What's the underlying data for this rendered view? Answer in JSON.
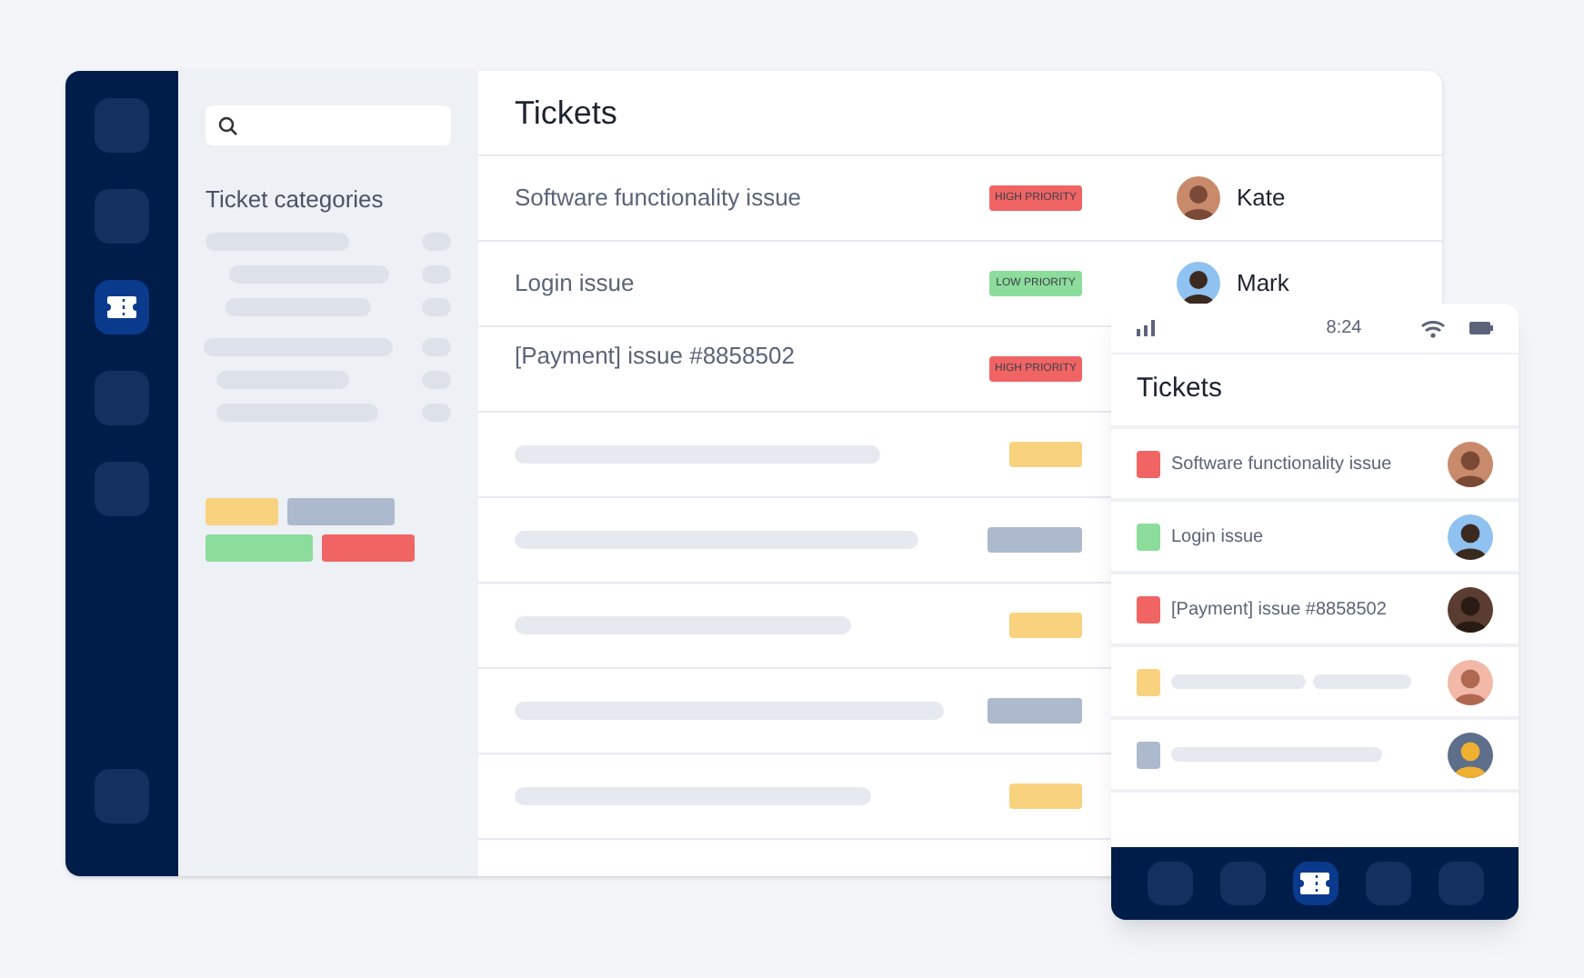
{
  "nav": {
    "items": [
      {
        "selected": false
      },
      {
        "selected": false
      },
      {
        "selected": true
      },
      {
        "selected": false
      },
      {
        "selected": false
      }
    ],
    "footer_items": [
      {
        "selected": false
      }
    ]
  },
  "sidebar": {
    "title": "Ticket categories",
    "tags": [
      {
        "color": "#f9d27f"
      },
      {
        "color": "#adb9cc"
      },
      {
        "color": "#8cdc9c"
      },
      {
        "color": "#f06464"
      }
    ]
  },
  "tickets": {
    "title": "Tickets",
    "rows": [
      {
        "kind": "ticket",
        "subject": "Software functionality issue",
        "priority": "HIGH PRIORITY",
        "color": "#f06464",
        "assignee": "Kate"
      },
      {
        "kind": "ticket",
        "subject": "Login issue",
        "priority": "LOW PRIORITY",
        "color": "#8cdc9c",
        "assignee": "Mark"
      },
      {
        "kind": "ticket",
        "subject": "[Payment] issue #8858502",
        "priority": "HIGH PRIORITY",
        "color": "#f06464"
      },
      {
        "kind": "placeholder",
        "color": "#f9d27f"
      },
      {
        "kind": "placeholder",
        "color": "#adb9cc"
      },
      {
        "kind": "placeholder",
        "color": "#f9d27f"
      },
      {
        "kind": "placeholder",
        "color": "#adb9cc"
      },
      {
        "kind": "placeholder",
        "color": "#f9d27f"
      }
    ]
  },
  "phone": {
    "time": "8:24",
    "title": "Tickets",
    "rows": [
      {
        "kind": "ticket",
        "subject": "Software functionality issue",
        "color": "#f06464"
      },
      {
        "kind": "ticket",
        "subject": "Login issue",
        "color": "#8cdc9c"
      },
      {
        "kind": "ticket",
        "subject": "[Payment] issue #8858502",
        "color": "#f06464"
      },
      {
        "kind": "placeholder",
        "color": "#f9d27f"
      },
      {
        "kind": "placeholder",
        "color": "#adb9cc"
      }
    ],
    "nav_items": [
      {
        "selected": false
      },
      {
        "selected": false
      },
      {
        "selected": true
      },
      {
        "selected": false
      },
      {
        "selected": false
      }
    ]
  }
}
